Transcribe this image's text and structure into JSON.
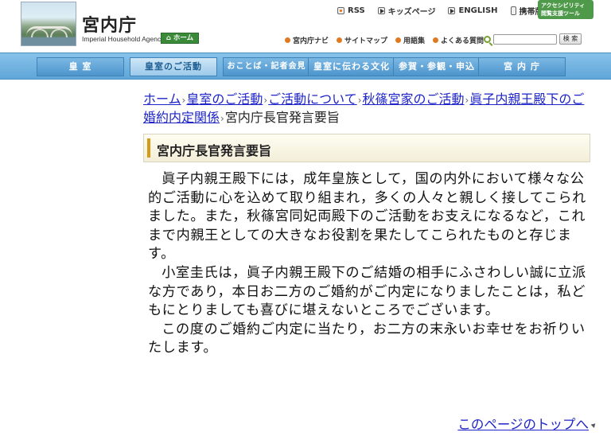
{
  "header": {
    "logo_title": "宮内庁",
    "logo_subtitle": "Imperial Household Agency",
    "home_label": "ホーム",
    "top_links": [
      "RSS",
      "キッズページ",
      "ENGLISH",
      "携帯版"
    ],
    "accessibility_line1": "アクセシビリティ",
    "accessibility_line2": "閲覧支援ツール",
    "sub_links": [
      "宮内庁ナビ",
      "サイトマップ",
      "用語集",
      "よくある質問"
    ],
    "search_placeholder": "",
    "search_button": "検 索"
  },
  "nav": {
    "items": [
      "皇 室",
      "皇室のご活動",
      "おことば・記者会見",
      "皇室に伝わる文化",
      "参賀・参観・申込",
      "宮 内 庁"
    ],
    "active_index": 1
  },
  "breadcrumb": {
    "links": [
      "ホーム",
      "皇室のご活動",
      "ご活動について",
      "秋篠宮家のご活動",
      "眞子内親王殿下のご婚約内定関係"
    ],
    "current": "宮内庁長官発言要旨"
  },
  "page_title": "宮内庁長官発言要旨",
  "paragraphs": [
    "眞子内親王殿下には，成年皇族として，国の内外において様々な公的ご活動に心を込めて取り組まれ，多くの人々と親しく接してこられました。また，秋篠宮同妃両殿下のご活動をお支えになるなど，これまで内親王としての大きなお役割を果たしてこられたものと存じます。",
    "小室圭氏は，眞子内親王殿下のご結婚の相手にふさわしい誠に立派な方であり，本日お二方のご婚約がご内定になりましたことは，私どもにとりましても喜びに堪えないところでございます。",
    "この度のご婚約ご内定に当たり，お二方の末永いお幸せをお祈りいたします。"
  ],
  "page_top_link": "このページのトップへ"
}
